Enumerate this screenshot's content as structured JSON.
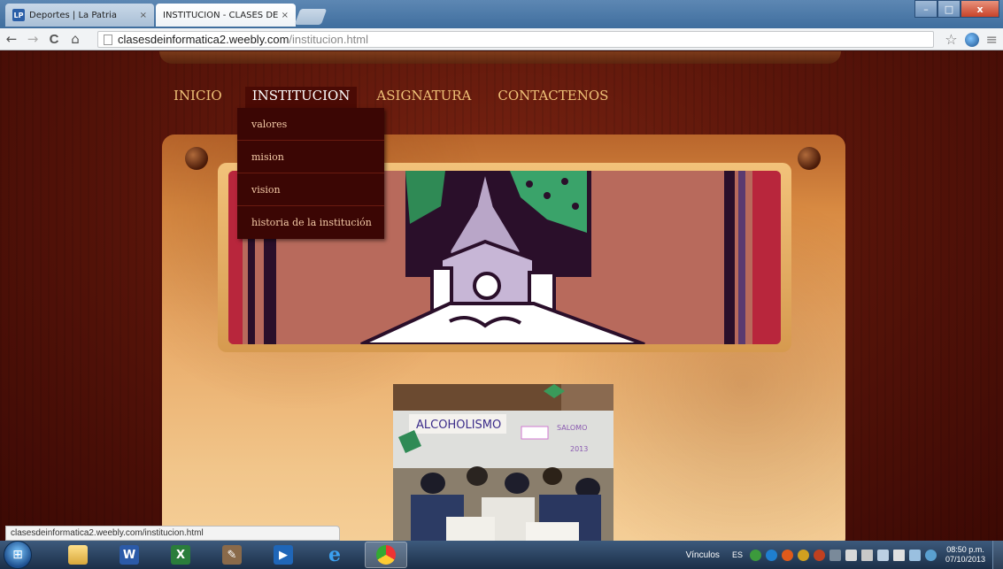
{
  "browser": {
    "tabs": [
      {
        "title": "Deportes | La Patria",
        "favicon": "LP",
        "close": "×"
      },
      {
        "title": "INSTITUCION - CLASES DE",
        "close": "×"
      }
    ],
    "nav_icons": {
      "back": "←",
      "forward": "→",
      "reload": "C",
      "home": "⌂"
    },
    "address": {
      "host": "clasesdeinformatica2.weebly.com",
      "path": "/institucion.html"
    },
    "window_buttons": {
      "minimize": "–",
      "maximize": "□",
      "close": "x"
    },
    "star": "☆",
    "menu": "≡"
  },
  "site": {
    "nav": [
      "INICIO",
      "INSTITUCION",
      "ASIGNATURA",
      "CONTACTENOS"
    ],
    "active_nav": "INSTITUCION",
    "dropdown": [
      "valores",
      "mision",
      "vision",
      "historia de la institución"
    ]
  },
  "status_url": "clasesdeinformatica2.weebly.com/institucion.html",
  "taskbar": {
    "vinculos": "Vínculos",
    "lang": "ES",
    "time": "08:50 p.m.",
    "date": "07/10/2013"
  },
  "colors": {
    "nav_text": "#f0c278",
    "dropdown_bg": "#3b0604",
    "page_bg": "#5a150a"
  }
}
